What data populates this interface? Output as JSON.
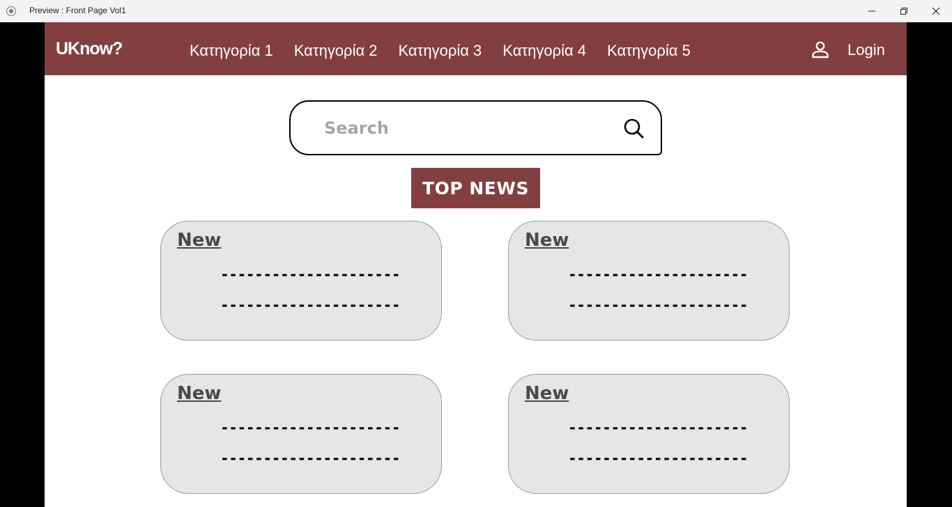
{
  "window": {
    "title": "Preview : Front Page Vol1"
  },
  "colors": {
    "brand": "#833f40",
    "card_bg": "#e6e6e6"
  },
  "navbar": {
    "logo": "UKnow?",
    "categories": [
      "Κατηγορία 1",
      "Κατηγορία 2",
      "Κατηγορία 3",
      "Κατηγορία 4",
      "Κατηγορία 5"
    ],
    "login_label": "Login",
    "user_icon": "user-icon"
  },
  "search": {
    "placeholder": "Search",
    "value": "",
    "icon": "search-icon"
  },
  "top_news": {
    "label": "TOP NEWS",
    "cards": [
      {
        "title": "New",
        "line1": "---------------------",
        "line2": "---------------------"
      },
      {
        "title": "New",
        "line1": "---------------------",
        "line2": "---------------------"
      },
      {
        "title": "New",
        "line1": "---------------------",
        "line2": "---------------------"
      },
      {
        "title": "New",
        "line1": "---------------------",
        "line2": "---------------------"
      }
    ]
  }
}
